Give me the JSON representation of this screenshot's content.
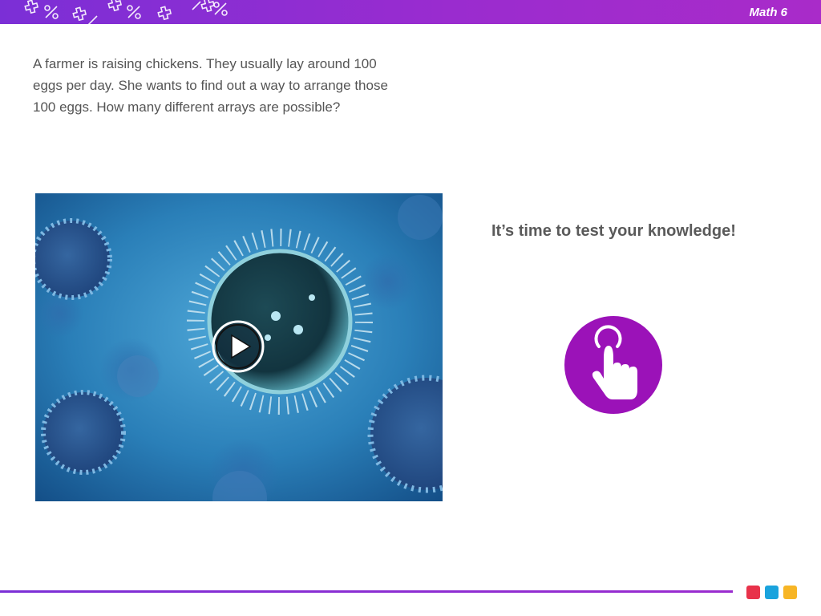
{
  "header": {
    "title": "Math 6",
    "pattern_icons": [
      "plus-icon",
      "percent-icon",
      "plus-icon",
      "percent-icon",
      "plus-icon",
      "percent-icon",
      "plus-icon",
      "percent-icon"
    ]
  },
  "question": {
    "text": "A farmer is raising chickens. They usually lay around 100 eggs per day. She wants to find out a way to arrange those 100 eggs. How many different arrays are possible?"
  },
  "video": {
    "thumbnail": "virus-illustration-image",
    "play_icon": "play-icon"
  },
  "prompt": {
    "text": "It’s time to test your knowledge!"
  },
  "tap_button": {
    "icon": "hand-pointer-icon",
    "color": "#9b12b8"
  },
  "footer": {
    "dots": [
      {
        "name": "red",
        "color": "#e8324a"
      },
      {
        "name": "blue",
        "color": "#1aa3dd"
      },
      {
        "name": "yellow",
        "color": "#f7b525"
      }
    ]
  },
  "colors": {
    "header_start": "#7b2fd6",
    "header_end": "#a92bc9",
    "text": "#555555"
  }
}
